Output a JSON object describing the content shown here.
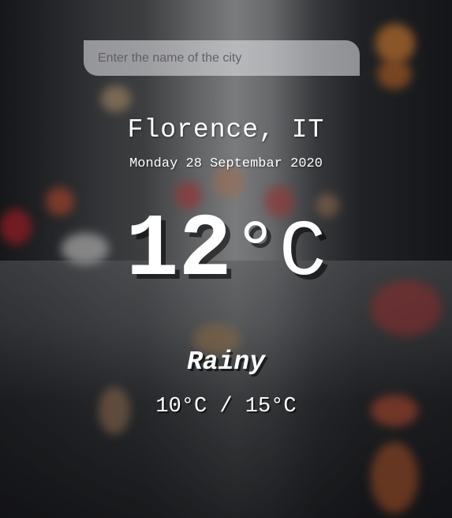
{
  "search": {
    "placeholder": "Enter the name of the city",
    "value": ""
  },
  "location": {
    "city": "Florence, IT",
    "date": "Monday 28 Septembar 2020"
  },
  "current": {
    "temperature": "12",
    "unit": "°C",
    "condition": "Rainy"
  },
  "range": {
    "hilo": "10°C / 15°C"
  },
  "colors": {
    "text": "#ffffff",
    "search_bg": "#ebebee"
  }
}
